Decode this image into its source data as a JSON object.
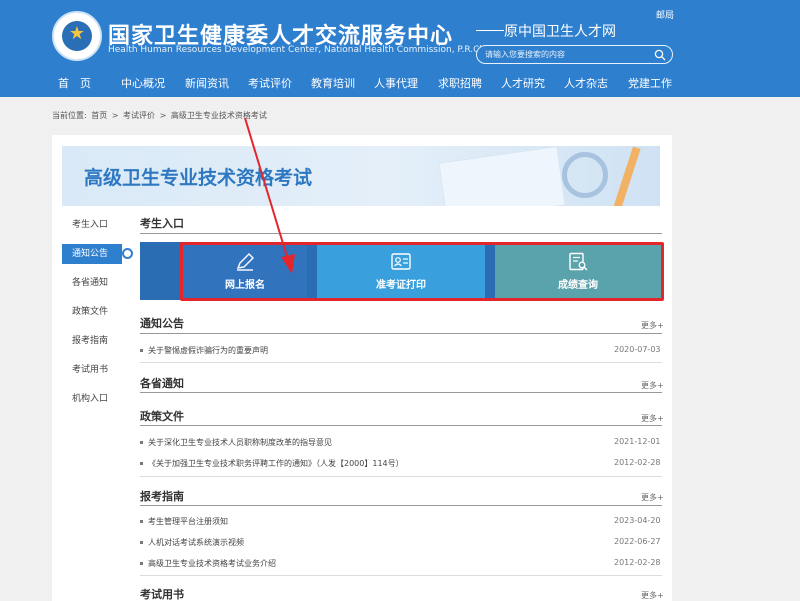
{
  "header": {
    "title": "国家卫生健康委人才交流服务中心",
    "subtitle": "Health Human Resources Development Center, National Health Commission, P.R.China",
    "former_name": "原中国卫生人才网",
    "top_link": "邮局",
    "search_placeholder": "请输入您要搜索的内容",
    "colors": {
      "header_bg": "#2f7fcf",
      "accent": "#2e78c2",
      "highlight": "#e3262c"
    }
  },
  "nav": [
    "首　页",
    "中心概况",
    "新闻资讯",
    "考试评价",
    "教育培训",
    "人事代理",
    "求职招聘",
    "人才研究",
    "人才杂志",
    "党建工作"
  ],
  "breadcrumb": {
    "prefix": "当前位置:",
    "items": [
      "首页",
      "考试评价",
      "高级卫生专业技术资格考试"
    ],
    "separator": ">"
  },
  "banner": {
    "title": "高级卫生专业技术资格考试"
  },
  "sidebar": {
    "items": [
      {
        "label": "考生入口",
        "active": false
      },
      {
        "label": "通知公告",
        "active": true
      },
      {
        "label": "各省通知",
        "active": false
      },
      {
        "label": "政策文件",
        "active": false
      },
      {
        "label": "报考指南",
        "active": false
      },
      {
        "label": "考试用书",
        "active": false
      },
      {
        "label": "机构入口",
        "active": false
      }
    ]
  },
  "entry": {
    "title": "考生入口",
    "buttons": [
      {
        "label": "网上报名",
        "icon": "pen-icon",
        "color": "#3273bd"
      },
      {
        "label": "准考证打印",
        "icon": "id-card-icon",
        "color": "#39a0dd"
      },
      {
        "label": "成绩查询",
        "icon": "document-search-icon",
        "color": "#5aa3ad"
      }
    ]
  },
  "sections": {
    "notices": {
      "title": "通知公告",
      "more": "更多+",
      "items": [
        {
          "text": "关于警惕虚假诈骗行为的重要声明",
          "date": "2020-07-03"
        }
      ]
    },
    "provinces": {
      "title": "各省通知",
      "more": "更多+",
      "items": []
    },
    "policies": {
      "title": "政策文件",
      "more": "更多+",
      "items": [
        {
          "text": "关于深化卫生专业技术人员职称制度改革的指导意见",
          "date": "2021-12-01"
        },
        {
          "text": "《关于加强卫生专业技术职务评聘工作的通知》（人发【2000】114号）",
          "date": "2012-02-28"
        }
      ]
    },
    "guide": {
      "title": "报考指南",
      "more": "更多+",
      "items": [
        {
          "text": "考生管理平台注册须知",
          "date": "2023-04-20"
        },
        {
          "text": "人机对话考试系统演示视频",
          "date": "2022-06-27"
        },
        {
          "text": "高级卫生专业技术资格考试业务介绍",
          "date": "2012-02-28"
        }
      ]
    },
    "books": {
      "title": "考试用书",
      "more": "更多+"
    }
  }
}
